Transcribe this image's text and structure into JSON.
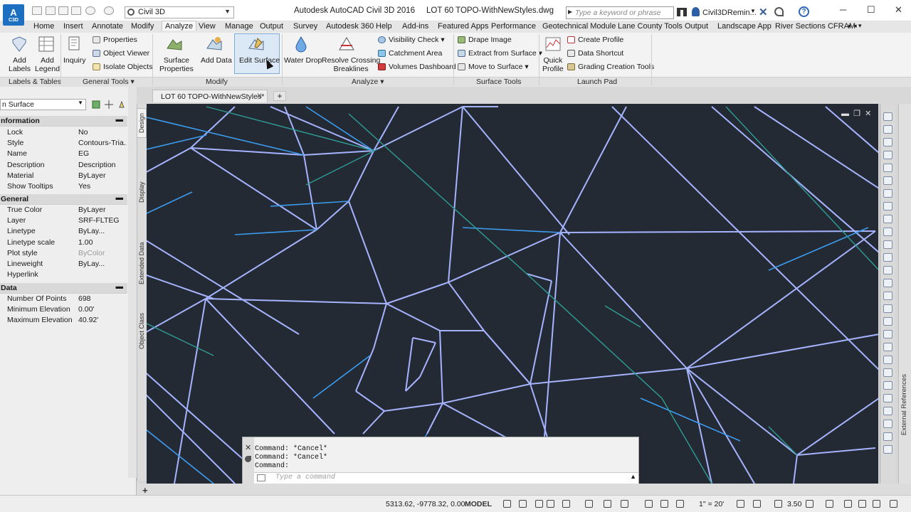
{
  "titlebar": {
    "workspace": "Civil 3D",
    "window_title": "Autodesk AutoCAD Civil 3D 2016     LOT 60 TOPO-WithNewStyles.dwg",
    "search_placeholder": "Type a keyword or phrase",
    "user_name": "Civil3DRemin...",
    "app_letter": "A",
    "app_sub": "C3D"
  },
  "menu": [
    "Home",
    "Insert",
    "Annotate",
    "Modify",
    "Analyze",
    "View",
    "Manage",
    "Output",
    "Survey",
    "Autodesk 360",
    "Help",
    "Add-ins",
    "Featured Apps",
    "Performance",
    "Geotechnical Module",
    "Lane County Tools",
    "Output",
    "Landscape App",
    "River Sections CFRAM"
  ],
  "ribbon": {
    "labels_tables": {
      "add_labels": "Add\nLabels",
      "add_legend": "Add\nLegend",
      "title": "Labels & Tables"
    },
    "general_tools": {
      "inquiry": "Inquiry",
      "properties": "Properties",
      "object_viewer": "Object Viewer",
      "isolate_objects": "Isolate Objects",
      "title": "General Tools"
    },
    "modify": {
      "surface_properties": "Surface\nProperties",
      "add_data": "Add Data",
      "edit_surface": "Edit Surface",
      "title": "Modify"
    },
    "analyze": {
      "water_drop": "Water Drop",
      "resolve_crossing": "Resolve Crossing\nBreaklines",
      "visibility_check": "Visibility Check",
      "catchment_area": "Catchment Area",
      "volumes_dashboard": "Volumes Dashboard",
      "title": "Analyze"
    },
    "surface_tools": {
      "drape_image": "Drape Image",
      "extract_from_surface": "Extract from Surface",
      "move_to_surface": "Move to Surface",
      "title": "Surface Tools"
    },
    "launch_pad": {
      "quick_profile": "Quick\nProfile",
      "create_profile": "Create Profile",
      "data_shortcut": "Data Shortcut",
      "grading_creation_tools": "Grading Creation Tools",
      "title": "Launch Pad"
    }
  },
  "palette": {
    "object_type": "n Surface",
    "tabs": [
      "Design",
      "Display",
      "Extended Data",
      "Object Class"
    ],
    "sections": {
      "information": "nformation",
      "general": "General",
      "data": "Data"
    },
    "information_rows": [
      {
        "name": "Lock",
        "value": "No"
      },
      {
        "name": "Style",
        "value": "Contours-Tria..."
      },
      {
        "name": "Name",
        "value": "EG"
      },
      {
        "name": "Description",
        "value": "Description"
      },
      {
        "name": "Material",
        "value": "ByLayer"
      },
      {
        "name": "Show Tooltips",
        "value": "Yes"
      }
    ],
    "general_rows": [
      {
        "name": "True Color",
        "value": "ByLayer"
      },
      {
        "name": "Layer",
        "value": "SRF-FLTEG"
      },
      {
        "name": "Linetype",
        "value": "ByLay..."
      },
      {
        "name": "Linetype scale",
        "value": "1.00"
      },
      {
        "name": "Plot style",
        "value": "ByColor"
      },
      {
        "name": "Lineweight",
        "value": "ByLay..."
      },
      {
        "name": "Hyperlink",
        "value": ""
      }
    ],
    "data_rows": [
      {
        "name": "Number Of Points",
        "value": "698"
      },
      {
        "name": "Minimum Elevation",
        "value": "0.00'"
      },
      {
        "name": "Maximum Elevation",
        "value": "40.92'"
      }
    ]
  },
  "document": {
    "tab_label": "LOT 60 TOPO-WithNewStyles*",
    "new_tab": "+"
  },
  "command_line": {
    "history": [
      "Command: *Cancel*",
      "Command: *Cancel*",
      "Command:"
    ],
    "placeholder": "Type a command"
  },
  "right_panel": {
    "external_references": "External References"
  },
  "statusbar": {
    "coords": "5313.62, -9778.32, 0.00",
    "model": "MODEL",
    "scale": "1\" = 20'",
    "zoom": "3.50",
    "layout_add": "+"
  },
  "colors": {
    "surface_line": "#a6b4ff",
    "tin_blue": "#3c9cf0",
    "contour_teal": "#2e9c95",
    "canvas_bg": "#232a33"
  }
}
